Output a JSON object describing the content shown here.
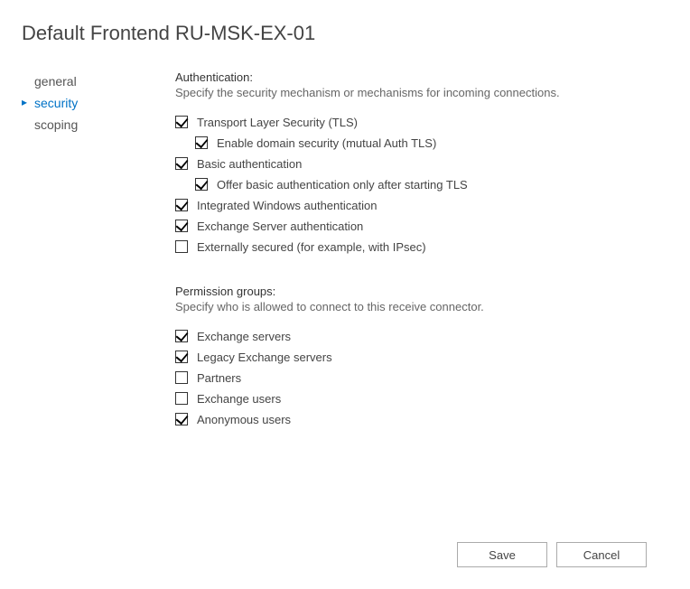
{
  "title": "Default Frontend RU-MSK-EX-01",
  "sidebar": {
    "items": [
      {
        "label": "general",
        "active": false
      },
      {
        "label": "security",
        "active": true
      },
      {
        "label": "scoping",
        "active": false
      }
    ]
  },
  "content": {
    "auth": {
      "header": "Authentication:",
      "description": "Specify the security mechanism or mechanisms for incoming connections.",
      "options": [
        {
          "label": "Transport Layer Security (TLS)",
          "checked": true,
          "indent": false
        },
        {
          "label": "Enable domain security (mutual Auth TLS)",
          "checked": true,
          "indent": true
        },
        {
          "label": "Basic authentication",
          "checked": true,
          "indent": false
        },
        {
          "label": "Offer basic authentication only after starting TLS",
          "checked": true,
          "indent": true
        },
        {
          "label": "Integrated Windows authentication",
          "checked": true,
          "indent": false
        },
        {
          "label": "Exchange Server authentication",
          "checked": true,
          "indent": false
        },
        {
          "label": "Externally secured (for example, with IPsec)",
          "checked": false,
          "indent": false
        }
      ]
    },
    "perm": {
      "header": "Permission groups:",
      "description": "Specify who is allowed to connect to this receive connector.",
      "options": [
        {
          "label": "Exchange servers",
          "checked": true
        },
        {
          "label": "Legacy Exchange servers",
          "checked": true
        },
        {
          "label": "Partners",
          "checked": false
        },
        {
          "label": "Exchange users",
          "checked": false
        },
        {
          "label": "Anonymous users",
          "checked": true
        }
      ]
    }
  },
  "buttons": {
    "save": "Save",
    "cancel": "Cancel"
  }
}
